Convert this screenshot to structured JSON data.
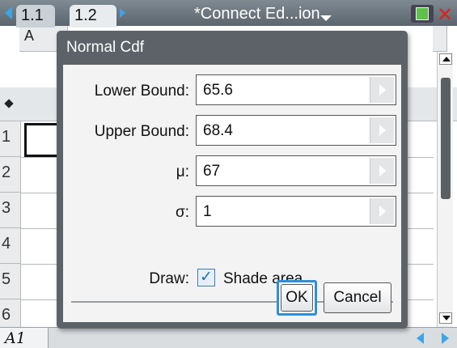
{
  "topbar": {
    "tabs": [
      {
        "label": "1.1"
      },
      {
        "label": "1.2"
      }
    ],
    "document_title": "*Connect Ed...ion"
  },
  "sheet": {
    "column_a": "A",
    "rows": [
      "1",
      "2",
      "3",
      "4",
      "5",
      "6"
    ],
    "selected_cell": "A1"
  },
  "dialog": {
    "title": "Normal Cdf",
    "fields": [
      {
        "label": "Lower Bound:",
        "value": "65.6"
      },
      {
        "label": "Upper Bound:",
        "value": "68.4"
      },
      {
        "label": "μ:",
        "value": "67"
      },
      {
        "label": "σ:",
        "value": "1"
      }
    ],
    "draw_label": "Draw:",
    "shade": {
      "label": "Shade area",
      "checked": true
    },
    "ok_label": "OK",
    "cancel_label": "Cancel"
  },
  "colors": {
    "accent": "#3da4e8",
    "dialog_frame": "#5c6268"
  }
}
